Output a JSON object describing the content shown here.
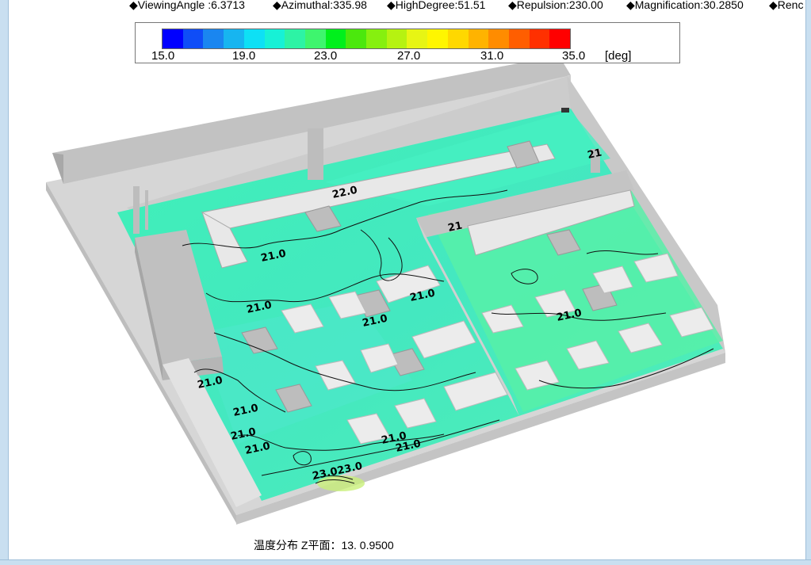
{
  "status_bar": {
    "viewing_angle": "◆ViewingAngle :6.3713",
    "azimuthal": "◆Azimuthal:335.98",
    "high_degree": "◆HighDegree:51.51",
    "repulsion": "◆Repulsion:230.00",
    "magnification": "◆Magnification:30.2850",
    "render": "◆Renc"
  },
  "legend": {
    "ticks": [
      "15.0",
      "19.0",
      "23.0",
      "27.0",
      "31.0",
      "35.0"
    ],
    "unit": "[deg]",
    "colors": [
      "#0000ff",
      "#0f4df7",
      "#1a86f0",
      "#17b5f0",
      "#0ee0f5",
      "#17f1d6",
      "#2df3a5",
      "#3ef56e",
      "#00f01c",
      "#4be80d",
      "#86f00f",
      "#b6f211",
      "#e7f514",
      "#fff600",
      "#ffd800",
      "#ffb300",
      "#ff8c00",
      "#ff5e00",
      "#ff3000",
      "#ff0000"
    ]
  },
  "contour_labels": [
    {
      "text": "22.0"
    },
    {
      "text": "21.0"
    },
    {
      "text": "21.0"
    },
    {
      "text": "21.0"
    },
    {
      "text": "21.0"
    },
    {
      "text": "21.0"
    },
    {
      "text": "21.0"
    },
    {
      "text": "21.0"
    },
    {
      "text": "21.0"
    },
    {
      "text": "21.0"
    },
    {
      "text": "21.0"
    },
    {
      "text": "21.0"
    },
    {
      "text": "21"
    },
    {
      "text": "21"
    },
    {
      "text": "23.023.0"
    }
  ],
  "caption": "温度分布 Z平面：13.  0.9500"
}
